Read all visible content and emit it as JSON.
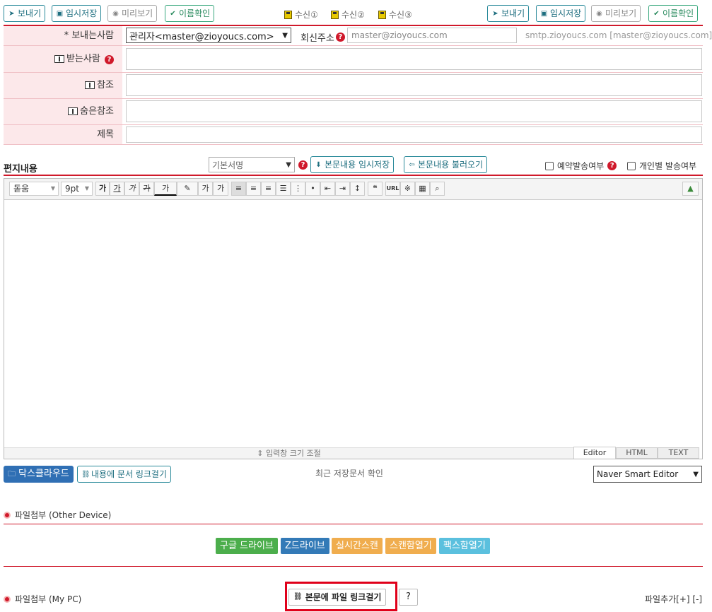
{
  "toolbar": {
    "send": "보내기",
    "temp_save": "임시저장",
    "preview": "미리보기",
    "name_check": "이름확인",
    "recv1": "수신①",
    "recv2": "수신②",
    "recv3": "수신③"
  },
  "form": {
    "sender_label": "* 보내는사람",
    "sender_value": "관리자<master@zioyoucs.com>",
    "reply_label": "회신주소",
    "reply_value": "master@zioyoucs.com",
    "smtp_text": "smtp.zioyoucs.com [master@zioyoucs.com]",
    "to_label": "받는사람",
    "cc_label": "참조",
    "bcc_label": "숨은참조",
    "subject_label": "제목"
  },
  "content_bar": {
    "title": "편지내용",
    "signature": "기본서명",
    "temp_save_body": "본문내용 임시저장",
    "load_body": "본문내용 불러오기",
    "reserve": "예약발송여부",
    "individual": "개인별 발송여부"
  },
  "editor": {
    "font": "돋움",
    "size": "9pt",
    "resize": "입력창 크기 조절",
    "tab_editor": "Editor",
    "tab_html": "HTML",
    "tab_text": "TEXT",
    "tools": {
      "bold": "가",
      "underline": "가",
      "italic": "가",
      "strike": "가",
      "fontcolor": "가",
      "superscript": "가",
      "subscript": "가",
      "quote": "❝",
      "url": "URL",
      "special": "※"
    }
  },
  "below_editor": {
    "docs_cloud": "닥스클라우드",
    "doc_link": "내용에 문서 링크걸기",
    "recent": "최근 저장문서 확인",
    "editor_select": "Naver Smart Editor"
  },
  "attach_other": {
    "title": "파일첨부",
    "sub": "(Other Device)",
    "google": "구글 드라이브",
    "zdrive": "Z드라이브",
    "scan_live": "실시간스캔",
    "scan_box": "스캔함열기",
    "fax_box": "팩스함열기"
  },
  "attach_pc": {
    "title": "파일첨부",
    "sub": "(My PC)",
    "link_btn": "본문에 파일 링크걸기",
    "help": "?",
    "add": "파일추가[+] [-]"
  },
  "colors": {
    "accent": "#1f6f80",
    "red_line": "#d0192b",
    "label_bg": "#fce8ea",
    "google": "#4cae4c",
    "zdrive": "#337ab7",
    "scan": "#f0ad4e",
    "fax": "#5bc0de"
  }
}
